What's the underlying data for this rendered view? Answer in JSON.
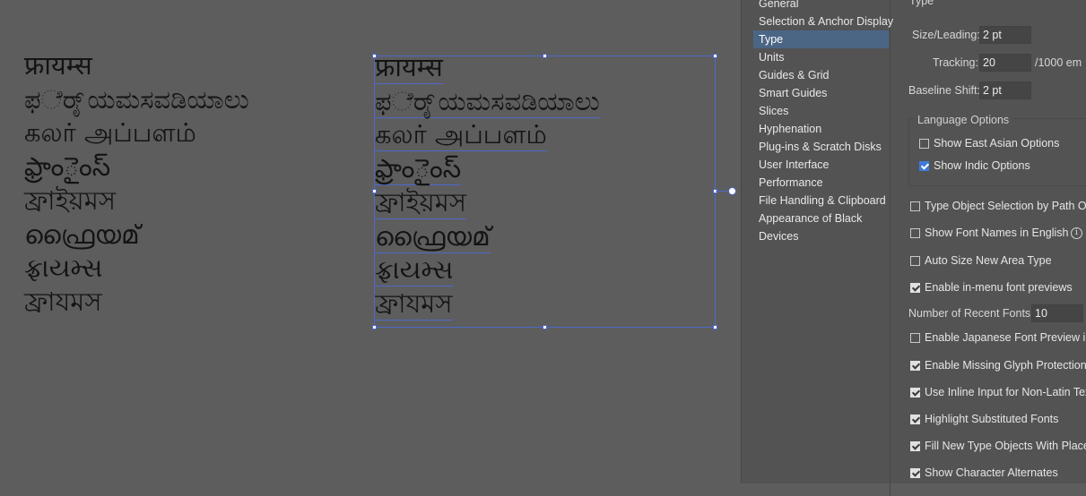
{
  "canvas": {
    "text_lines": [
      "फ्रायम्स",
      "ಫರ್ೈಯಮಸವಡಿಯಾಲು",
      "கலர் அப்பளம்",
      "ఫ్రాంైంస్",
      "ফ্রাইয়মস",
      "ഫ്രൈയമ്",
      "ફ્રાયમ્સ",
      "ফ্রাযমস"
    ]
  },
  "prefs": {
    "section_header": "Type",
    "categories": [
      {
        "label": "General",
        "active": false
      },
      {
        "label": "Selection & Anchor Display",
        "active": false
      },
      {
        "label": "Type",
        "active": true
      },
      {
        "label": "Units",
        "active": false
      },
      {
        "label": "Guides & Grid",
        "active": false
      },
      {
        "label": "Smart Guides",
        "active": false
      },
      {
        "label": "Slices",
        "active": false
      },
      {
        "label": "Hyphenation",
        "active": false
      },
      {
        "label": "Plug-ins & Scratch Disks",
        "active": false
      },
      {
        "label": "User Interface",
        "active": false
      },
      {
        "label": "Performance",
        "active": false
      },
      {
        "label": "File Handling & Clipboard",
        "active": false
      },
      {
        "label": "Appearance of Black",
        "active": false
      },
      {
        "label": "Devices",
        "active": false
      }
    ],
    "size_leading": {
      "label": "Size/Leading:",
      "value": "2 pt"
    },
    "tracking": {
      "label": "Tracking:",
      "value": "20",
      "unit": "/1000 em"
    },
    "baseline_shift": {
      "label": "Baseline Shift:",
      "value": "2 pt"
    },
    "language_options": {
      "title": "Language Options",
      "east_asian": {
        "label": "Show East Asian Options",
        "checked": false
      },
      "indic": {
        "label": "Show Indic Options",
        "checked": true
      }
    },
    "options": [
      {
        "label": "Type Object Selection by Path Onl",
        "checked": false
      },
      {
        "label": "Show Font Names in English",
        "checked": false
      },
      {
        "label": "Auto Size New Area Type",
        "checked": false
      },
      {
        "label": "Enable in-menu font previews",
        "checked": true
      }
    ],
    "recent_fonts": {
      "label": "Number of Recent Fonts:",
      "value": "10"
    },
    "options2": [
      {
        "label": "Enable Japanese Font Preview in",
        "checked": false
      },
      {
        "label": "Enable Missing Glyph Protection",
        "checked": true
      },
      {
        "label": "Use Inline Input for Non-Latin Tex",
        "checked": true
      },
      {
        "label": "Highlight Substituted Fonts",
        "checked": true
      },
      {
        "label": "Fill New Type Objects With Placeh",
        "checked": true
      },
      {
        "label": "Show Character Alternates",
        "checked": true
      }
    ],
    "info_glyph": "i"
  }
}
